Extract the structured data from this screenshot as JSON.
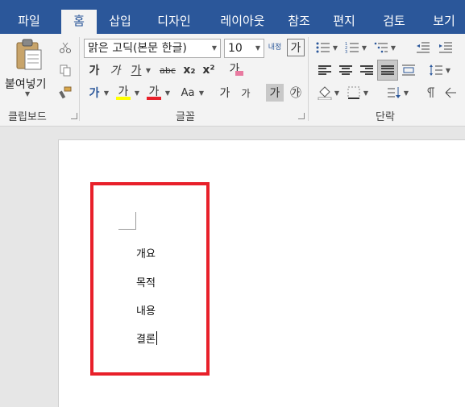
{
  "tabs": [
    "파일",
    "홈",
    "삽입",
    "디자인",
    "레이아웃",
    "참조",
    "편지",
    "검토",
    "보기"
  ],
  "clipboard": {
    "paste_label": "붙여넣기",
    "group_label": "클립보드"
  },
  "font": {
    "name": "맑은 고딕(본문 한글)",
    "size": "10",
    "group_label": "글꼴",
    "bold": "가",
    "italic": "가",
    "underline": "가",
    "strike": "abc",
    "sub": "x₂",
    "sup": "x²",
    "effects": "가",
    "highlight": "가",
    "font_color": "가",
    "change_case": "Aa",
    "grow": "가",
    "shrink": "가",
    "shading": "가",
    "enclose": "㉮",
    "phonetic": "내정",
    "char_border": "가"
  },
  "paragraph": {
    "group_label": "단락"
  },
  "colors": {
    "accent": "#2b579a",
    "highlight_bar": "#ffff00",
    "font_color_bar": "#e8202a",
    "annotation": "#e8202a"
  },
  "document": {
    "paragraphs": [
      "개요",
      "목적",
      "내용",
      "결론"
    ]
  }
}
